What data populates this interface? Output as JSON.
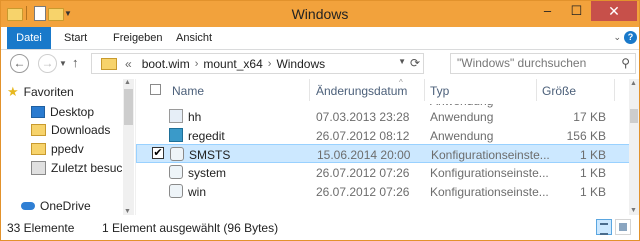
{
  "window": {
    "title": "Windows",
    "buttons": {
      "minimize": "–",
      "maximize": "☐",
      "close": "✕"
    }
  },
  "ribbon": {
    "tabs": [
      "Datei",
      "Start",
      "Freigeben",
      "Ansicht"
    ],
    "help_label": "?"
  },
  "address": {
    "overflow": "«",
    "crumbs": [
      "boot.wim",
      "mount_x64",
      "Windows"
    ]
  },
  "search": {
    "placeholder": "\"Windows\" durchsuchen"
  },
  "nav": {
    "items": [
      {
        "label": "Favoriten",
        "icon": "star-icon"
      },
      {
        "label": "Desktop",
        "icon": "desktop-icon"
      },
      {
        "label": "Downloads",
        "icon": "downloads-folder-icon"
      },
      {
        "label": "ppedv",
        "icon": "folder-icon"
      },
      {
        "label": "Zuletzt besucht",
        "icon": "recent-places-icon"
      },
      {
        "label": "OneDrive",
        "icon": "onedrive-icon"
      }
    ]
  },
  "columns": {
    "name": "Name",
    "date": "Änderungsdatum",
    "type": "Typ",
    "size": "Größe"
  },
  "files": [
    {
      "name": "hh",
      "date": "07.03.2013 23:28",
      "type": "Anwendung",
      "size": "17 KB",
      "icon": "application-icon",
      "selected": false
    },
    {
      "name": "regedit",
      "date": "26.07.2012 08:12",
      "type": "Anwendung",
      "size": "156 KB",
      "icon": "regedit-icon",
      "selected": false
    },
    {
      "name": "SMSTS",
      "date": "15.06.2014 20:00",
      "type": "Konfigurationseinste...",
      "size": "1 KB",
      "icon": "config-file-icon",
      "selected": true,
      "checkmark": "✔"
    },
    {
      "name": "system",
      "date": "26.07.2012 07:26",
      "type": "Konfigurationseinste...",
      "size": "1 KB",
      "icon": "config-file-icon",
      "selected": false
    },
    {
      "name": "win",
      "date": "26.07.2012 07:26",
      "type": "Konfigurationseinste...",
      "size": "1 KB",
      "icon": "config-file-icon",
      "selected": false
    }
  ],
  "status": {
    "count": "33 Elemente",
    "selection": "1 Element ausgewählt (96 Bytes)"
  },
  "colors": {
    "titlebar": "#f2a23c",
    "accent": "#1979ca",
    "selection": "#cce8ff"
  }
}
